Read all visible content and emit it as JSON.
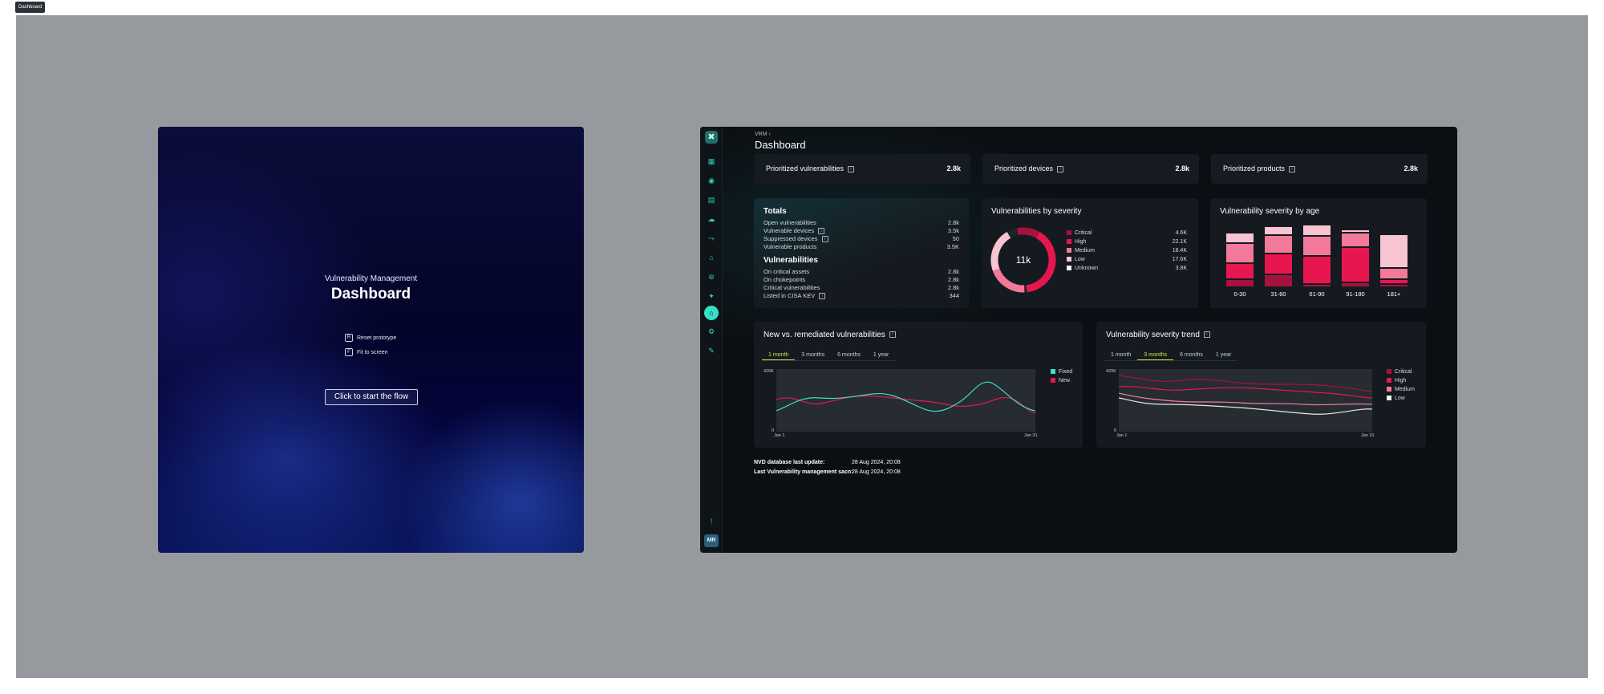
{
  "tab": "Dashboard",
  "intro": {
    "subtitle": "Vulnerability Management",
    "title": "Dashboard",
    "options": [
      {
        "key": "R",
        "label": "Reset prototype"
      },
      {
        "key": "F",
        "label": "Fit to screen"
      }
    ],
    "start": "Click to start the flow"
  },
  "dashboard": {
    "breadcrumb": "VRM  ›",
    "title": "Dashboard",
    "avatar": "MR",
    "kpis": [
      {
        "label": "Prioritized vulnerabilities",
        "value": "2.8k"
      },
      {
        "label": "Prioritized devices",
        "value": "2.8k"
      },
      {
        "label": "Prioritized products",
        "value": "2.8k"
      }
    ],
    "totals": {
      "title": "Totals",
      "rows": [
        {
          "label": "Open vulnerabilities",
          "value": "2.8k"
        },
        {
          "label": "Vulnerable devices",
          "value": "3.5k"
        },
        {
          "label": "Suppressed devices",
          "value": "50"
        },
        {
          "label": "Vulnerable products",
          "value": "3.5K"
        }
      ],
      "vuln_title": "Vulnerabilities",
      "vuln_rows": [
        {
          "label": "On critical assets",
          "value": "2.8k"
        },
        {
          "label": "On chokepoints",
          "value": "2.8k"
        },
        {
          "label": "Critical vulnerabilities",
          "value": "2.8k"
        },
        {
          "label": "Listed in CISA KEV",
          "value": "344"
        }
      ]
    },
    "severity": {
      "title": "Vulnerabilities by severity",
      "center": "11k",
      "items": [
        {
          "label": "Critical",
          "value": "4.6K",
          "color": "#a5123f"
        },
        {
          "label": "High",
          "value": "22.1K",
          "color": "#e8164f"
        },
        {
          "label": "Medium",
          "value": "18.4K",
          "color": "#f2799a"
        },
        {
          "label": "Low",
          "value": "17.6K",
          "color": "#f8c4d2"
        },
        {
          "label": "Unknown",
          "value": "3.8K",
          "color": "#f3f3f3"
        }
      ]
    },
    "age": {
      "title": "Vulnerability severity by age",
      "categories": [
        "0-30",
        "31-60",
        "61-90",
        "91-180",
        "181+"
      ]
    },
    "new_remediated": {
      "title": "New vs. remediated vulnerabilities",
      "tabs": [
        "1 month",
        "3 months",
        "6 months",
        "1 year"
      ],
      "active": 0,
      "ytop": "420K",
      "ybot": "0",
      "xstart": "Jan 1",
      "xend": "Jan 31",
      "legend": [
        {
          "label": "Fixed",
          "color": "#3fe0c5"
        },
        {
          "label": "New",
          "color": "#e8164f"
        }
      ]
    },
    "trend": {
      "title": "Vulnerability severity trend",
      "tabs": [
        "1 month",
        "3 months",
        "6 months",
        "1 year"
      ],
      "active": 1,
      "ytop": "420K",
      "ybot": "0",
      "xstart": "Jan 1",
      "xend": "Jan 31",
      "legend": [
        {
          "label": "Critical",
          "color": "#a5123f"
        },
        {
          "label": "High",
          "color": "#e8164f"
        },
        {
          "label": "Medium",
          "color": "#f2799a"
        },
        {
          "label": "Low",
          "color": "#f3f3f3"
        }
      ]
    },
    "footer": [
      {
        "label": "NVD database last update:",
        "value": "28 Aug 2024, 20:08"
      },
      {
        "label": "Last Vulnerability management sacn:",
        "value": "28 Aug 2024, 20:08"
      }
    ]
  }
}
